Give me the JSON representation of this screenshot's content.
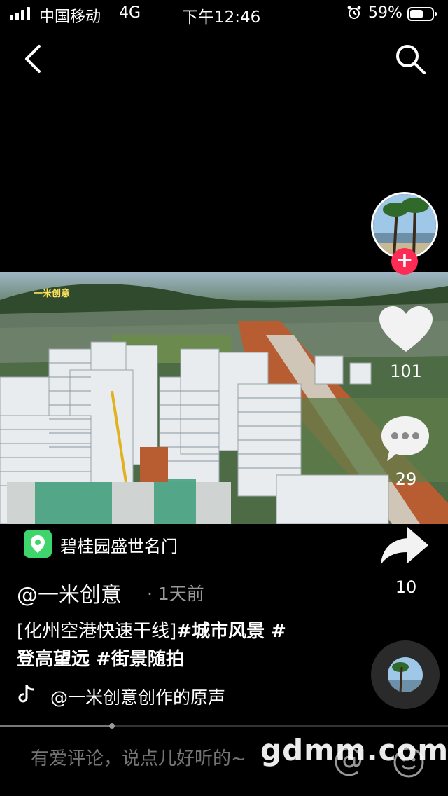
{
  "status_bar": {
    "carrier": "中国移动",
    "network": "4G",
    "time": "下午12:46",
    "battery": "59%",
    "battery_level": 0.59
  },
  "video": {
    "watermark_text": "一米创意"
  },
  "right_rail": {
    "like_count": "101",
    "comment_count": "29",
    "share_count": "10",
    "follow_symbol": "+"
  },
  "location": {
    "label": "碧桂园盛世名门"
  },
  "post": {
    "author": "@一米创意",
    "time_ago": "· 1天前",
    "caption_line1_plain": "[化州空港快速干线]",
    "caption_line1_tag": "#城市风景 #",
    "caption_line2": "登高望远 #街景随拍",
    "music": "@一米创意创作的原声"
  },
  "playback": {
    "progress": 0.25
  },
  "comment_bar": {
    "placeholder": "有爱评论，说点儿好听的~"
  },
  "site_watermark": "gdmm.com",
  "colors": {
    "accent_red": "#fe2c55",
    "location_green": "#3ed66c"
  },
  "icons": [
    "back-icon",
    "search-icon",
    "heart-icon",
    "comment-icon",
    "share-icon",
    "location-pin-icon",
    "music-note-icon",
    "at-icon",
    "emoji-icon",
    "alarm-icon"
  ]
}
